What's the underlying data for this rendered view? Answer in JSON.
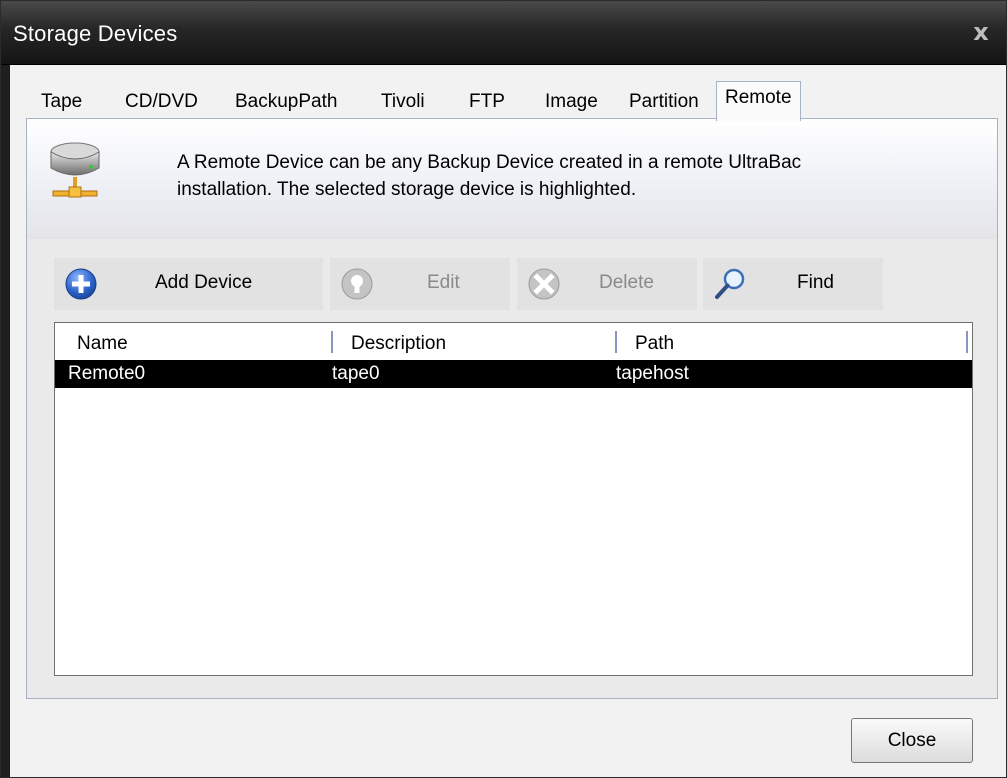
{
  "window": {
    "title": "Storage Devices",
    "close_glyph": "x"
  },
  "tabs": [
    {
      "label": "Tape"
    },
    {
      "label": "CD/DVD"
    },
    {
      "label": "BackupPath"
    },
    {
      "label": "Tivoli"
    },
    {
      "label": "FTP"
    },
    {
      "label": "Image"
    },
    {
      "label": "Partition"
    },
    {
      "label": "Remote",
      "active": true
    }
  ],
  "banner": {
    "icon": "remote-storage-icon",
    "line1": "A Remote Device can be any Backup Device created in a remote UltraBac",
    "line2": "installation.  The selected storage device is highlighted."
  },
  "toolbar": {
    "add": {
      "label": "Add Device",
      "icon": "add-circle-icon",
      "enabled": true
    },
    "edit": {
      "label": "Edit",
      "icon": "edit-icon",
      "enabled": false
    },
    "delete": {
      "label": "Delete",
      "icon": "delete-x-icon",
      "enabled": false
    },
    "find": {
      "label": "Find",
      "icon": "magnifier-icon",
      "enabled": true
    }
  },
  "list": {
    "columns": [
      "Name",
      "Description",
      "Path"
    ],
    "rows": [
      {
        "name": "Remote0",
        "description": "tape0",
        "path": "tapehost",
        "selected": true
      }
    ]
  },
  "footer": {
    "close_label": "Close"
  },
  "colors": {
    "title_bar": "#1a1a1a",
    "selection": "#000000",
    "add_icon": "#2a62c9"
  }
}
